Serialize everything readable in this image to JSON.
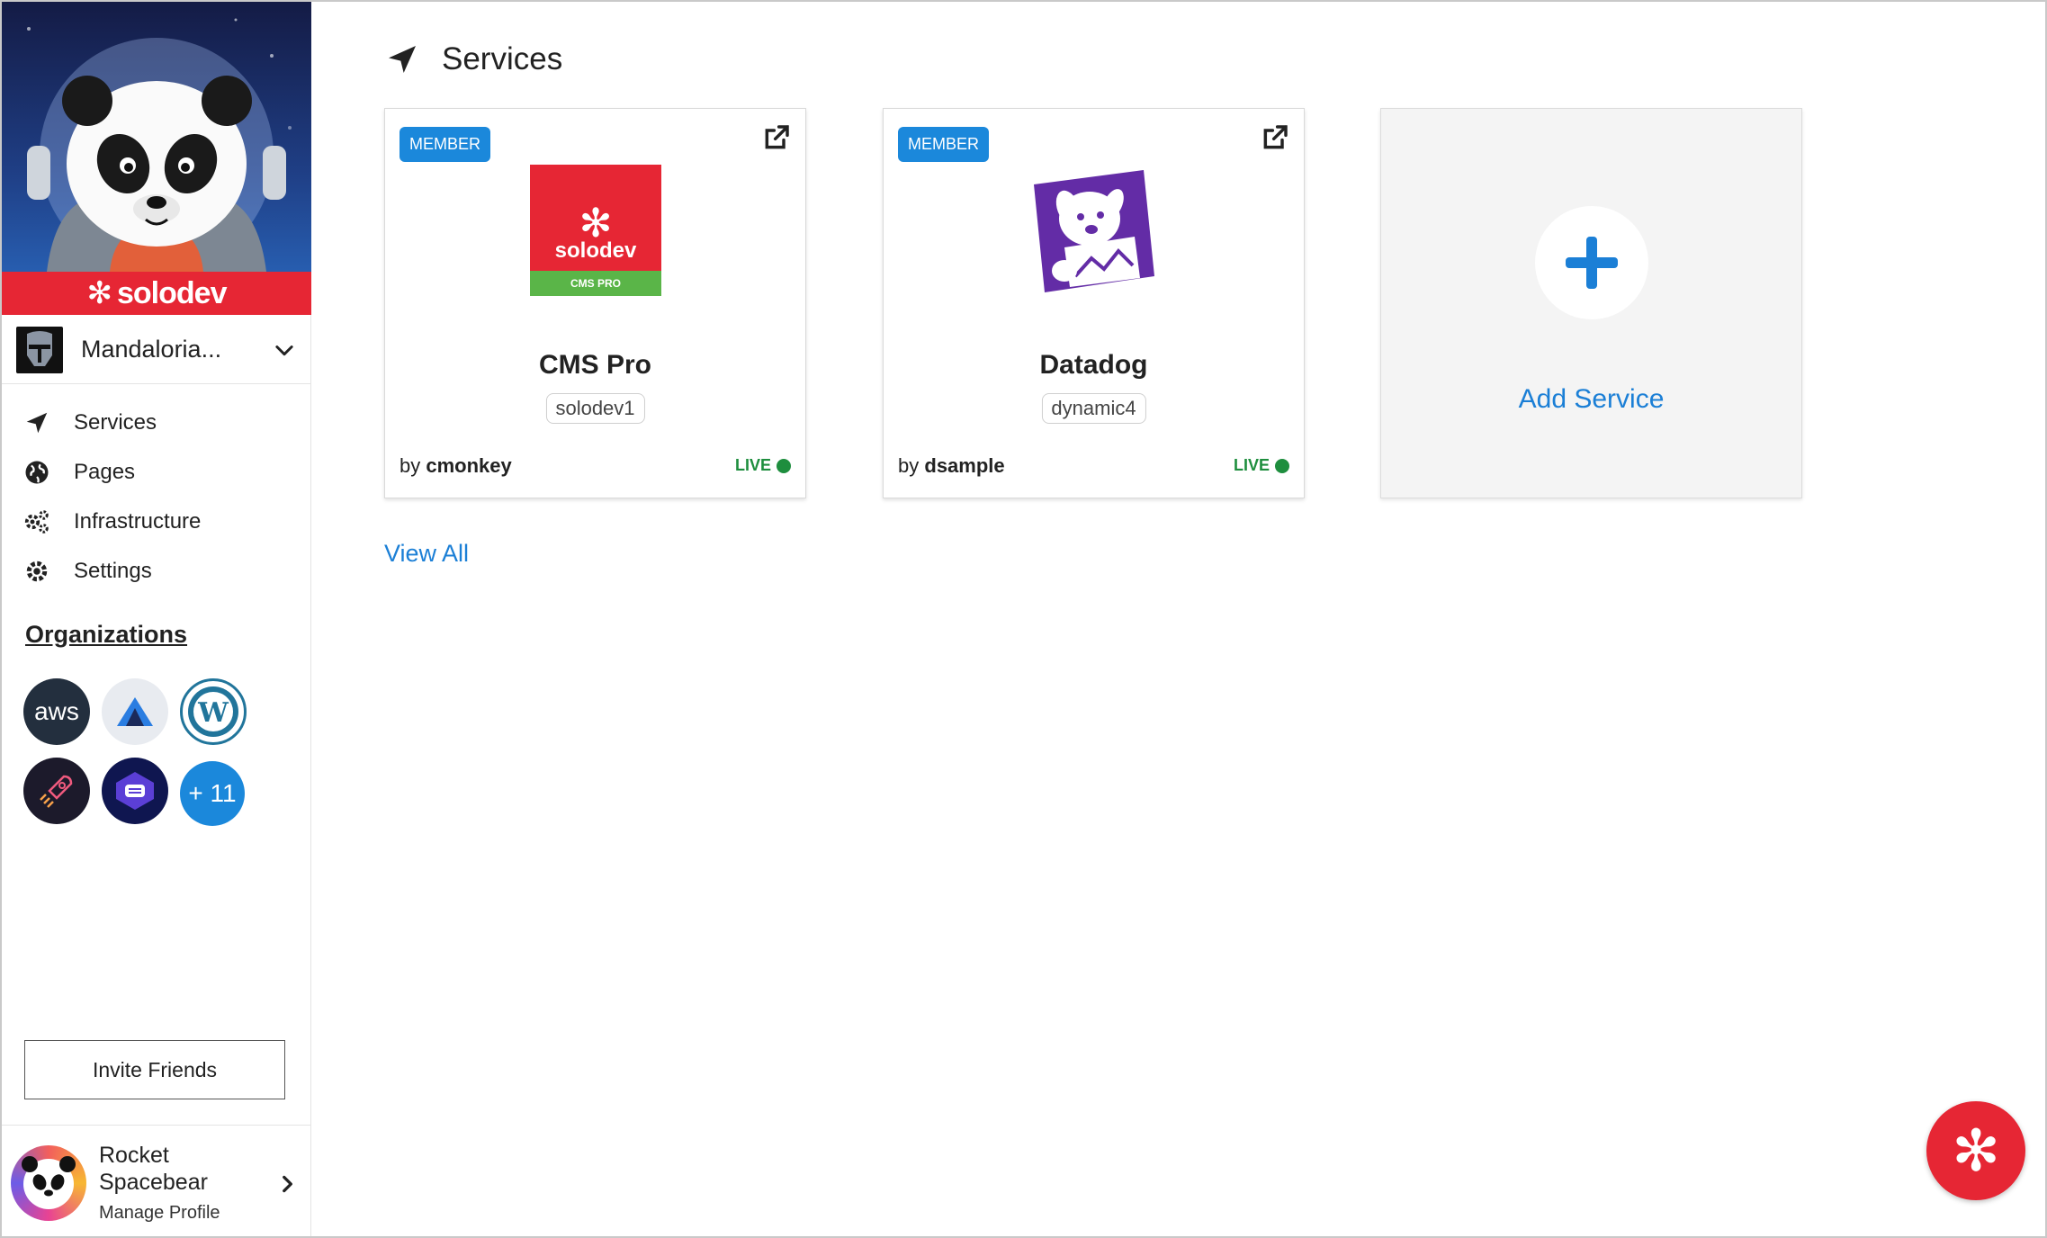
{
  "sidebar": {
    "brand": "solodev",
    "org_selector": {
      "name": "Mandaloria..."
    },
    "nav": [
      {
        "label": "Services",
        "icon": "location-arrow-icon"
      },
      {
        "label": "Pages",
        "icon": "globe-icon"
      },
      {
        "label": "Infrastructure",
        "icon": "cogs-icon"
      },
      {
        "label": "Settings",
        "icon": "gear-icon"
      }
    ],
    "organizations_title": "Organizations",
    "organizations": [
      {
        "name": "aws",
        "label": "aws"
      },
      {
        "name": "triangle-org",
        "label": ""
      },
      {
        "name": "wordpress",
        "label": ""
      },
      {
        "name": "rocket-org",
        "label": ""
      },
      {
        "name": "cube-org",
        "label": ""
      },
      {
        "name": "more",
        "label": "+ 11"
      }
    ],
    "invite_label": "Invite Friends",
    "profile": {
      "name": "Rocket Spacebear",
      "manage": "Manage Profile"
    }
  },
  "main": {
    "title": "Services",
    "services": [
      {
        "badge": "MEMBER",
        "name": "CMS Pro",
        "tag": "solodev1",
        "by_prefix": "by",
        "author": "cmonkey",
        "status": "LIVE",
        "logo_text": "solodev",
        "logo_sub": "CMS PRO"
      },
      {
        "badge": "MEMBER",
        "name": "Datadog",
        "tag": "dynamic4",
        "by_prefix": "by",
        "author": "dsample",
        "status": "LIVE"
      }
    ],
    "add_service_label": "Add Service",
    "view_all_label": "View All"
  },
  "colors": {
    "brand_red": "#e62634",
    "accent_blue": "#1b88db",
    "live_green": "#1e8e3e",
    "datadog_purple": "#632ca6"
  }
}
